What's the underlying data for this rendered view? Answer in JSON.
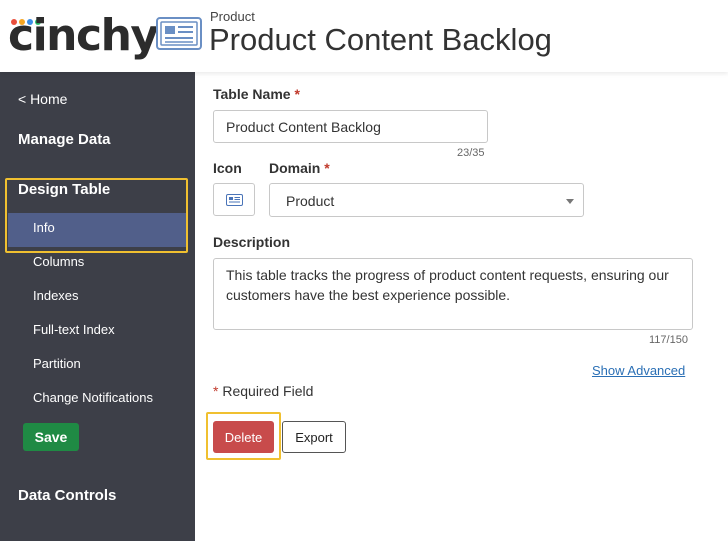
{
  "header": {
    "logo_text": "cinchy",
    "logo_dot_colors": [
      "#e94e3c",
      "#f5a623",
      "#3a8ee6",
      "#2ecc71"
    ],
    "domain": "Product",
    "title": "Product Content Backlog",
    "icon": "table-icon"
  },
  "sidebar": {
    "home": "< Home",
    "manage_data": "Manage Data",
    "design_table": "Design Table",
    "items": [
      {
        "label": "Info",
        "active": true
      },
      {
        "label": "Columns"
      },
      {
        "label": "Indexes"
      },
      {
        "label": "Full-text Index"
      },
      {
        "label": "Partition"
      },
      {
        "label": "Change Notifications"
      }
    ],
    "save_label": "Save",
    "data_controls": "Data Controls"
  },
  "form": {
    "table_name_label": "Table Name",
    "required_marker": "*",
    "table_name_value": "Product Content Backlog",
    "table_name_counter": "23/35",
    "icon_label": "Icon",
    "domain_label": "Domain",
    "domain_value": "Product",
    "description_label": "Description",
    "description_value": "This table tracks the progress of product content requests, ensuring our customers have the best experience possible.",
    "description_counter": "117/150",
    "show_advanced": "Show Advanced",
    "required_note": "Required Field",
    "delete_label": "Delete",
    "export_label": "Export"
  },
  "colors": {
    "sidebar_bg": "#3d3f48",
    "sidebar_active": "#515f8a",
    "save": "#1f8a44",
    "delete": "#c84b4b",
    "highlight": "#f0c030",
    "icon_blue": "#6a8fc4"
  }
}
